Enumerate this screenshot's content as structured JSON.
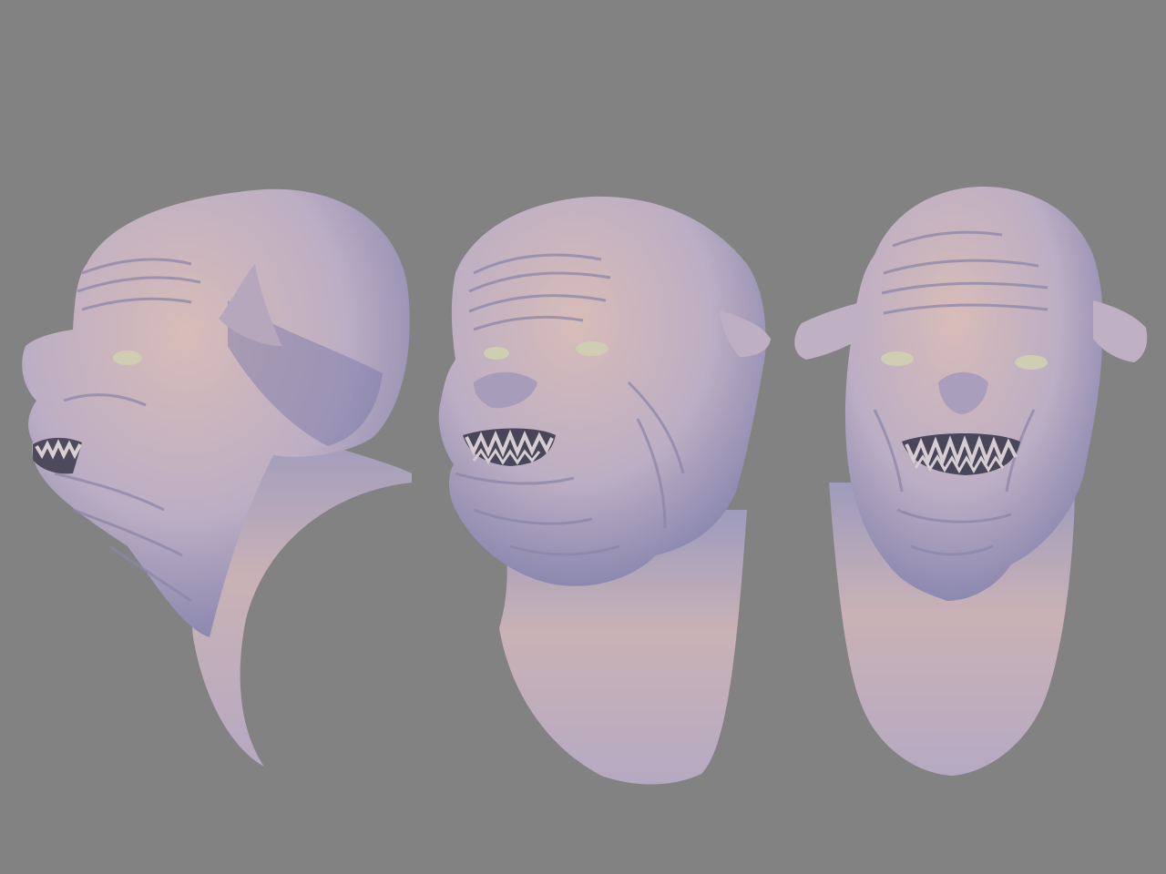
{
  "scene": {
    "background": "#828282",
    "clay_light": "#d3b6b4",
    "clay_mid": "#aea3c0",
    "clay_shadow": "#6e6e9c",
    "views": [
      {
        "name": "side-view"
      },
      {
        "name": "three-quarter-view"
      },
      {
        "name": "front-view"
      }
    ]
  }
}
